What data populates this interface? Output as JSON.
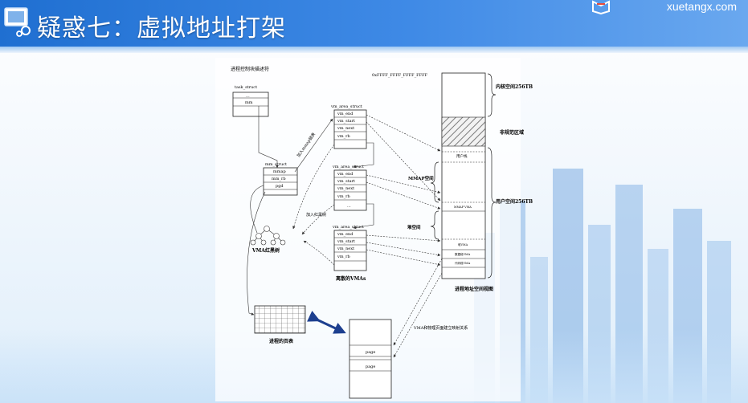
{
  "slide": {
    "title": "疑惑七：虚拟地址打架",
    "brand": "xuetangx.com"
  },
  "diagram": {
    "task_label": "进程控制块描述符",
    "task_struct": "task_struct",
    "task_fields": [
      "...",
      "mm"
    ],
    "mm_struct": "mm_struct",
    "mm_fields": [
      "mmap",
      "mm_rb",
      "pgd"
    ],
    "vma_struct_label": "vm_area_struct",
    "vma_fields": [
      "vm_end",
      "vm_start",
      "vm_next",
      "vm_rb"
    ],
    "vma_dots": "...",
    "add_mmap_list": "加入mmap链表",
    "add_rbtree": "加入红黑树",
    "vma_rbtree": "VMA红黑树",
    "process_vmas": "离散的VMAs",
    "page_table": "进程的页表",
    "vma_page_mapping": "VMA和物理页面建立映射关系",
    "page_label": "page",
    "address_top": "0xFFFF_FFFF_FFFF_FFFF",
    "kernel_space": "内核空间256TB",
    "noncanonical": "非规范区域",
    "user_stack": "用户栈",
    "mmap_space": "MMAP空间",
    "mmap_vma": "MMAP VMA",
    "user_space": "用户空间256TB",
    "heap_space": "堆空间",
    "heap_vma": "堆VMA",
    "data_vma": "数据段VMA",
    "code_vma": "代码段VMA",
    "process_address_space": "进程地址空间视图"
  }
}
